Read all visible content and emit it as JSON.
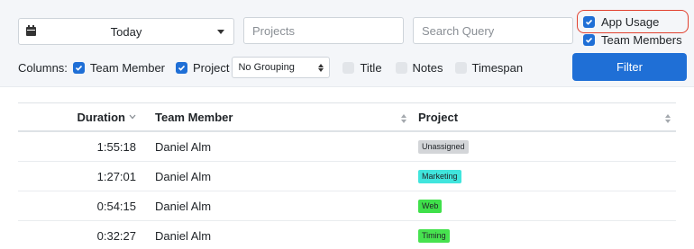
{
  "date_select": {
    "value": "Today"
  },
  "projects_input": {
    "placeholder": "Projects"
  },
  "query_input": {
    "placeholder": "Search Query"
  },
  "options": {
    "app_usage": {
      "label": "App Usage",
      "checked": true
    },
    "team_members": {
      "label": "Team Members",
      "checked": true
    }
  },
  "columns": {
    "label": "Columns:",
    "team_member": {
      "label": "Team Member",
      "checked": true
    },
    "project": {
      "label": "Project",
      "checked": true
    },
    "grouping": "No Grouping",
    "title": {
      "label": "Title",
      "checked": false
    },
    "notes": {
      "label": "Notes",
      "checked": false
    },
    "timespan": {
      "label": "Timespan",
      "checked": false
    }
  },
  "filter_button": "Filter",
  "table": {
    "headers": {
      "duration": "Duration",
      "team_member": "Team Member",
      "project": "Project"
    },
    "rows": [
      {
        "duration": "1:55:18",
        "member": "Daniel Alm",
        "project": "Unassigned",
        "project_color": "#d3d5d8"
      },
      {
        "duration": "1:27:01",
        "member": "Daniel Alm",
        "project": "Marketing",
        "project_color": "#40e5dd"
      },
      {
        "duration": "0:54:15",
        "member": "Daniel Alm",
        "project": "Web",
        "project_color": "#3fe04a"
      },
      {
        "duration": "0:32:27",
        "member": "Daniel Alm",
        "project": "Timing",
        "project_color": "#47e24f"
      }
    ]
  },
  "colors": {
    "accent": "#1f6fd6",
    "highlight": "#e2412f"
  }
}
